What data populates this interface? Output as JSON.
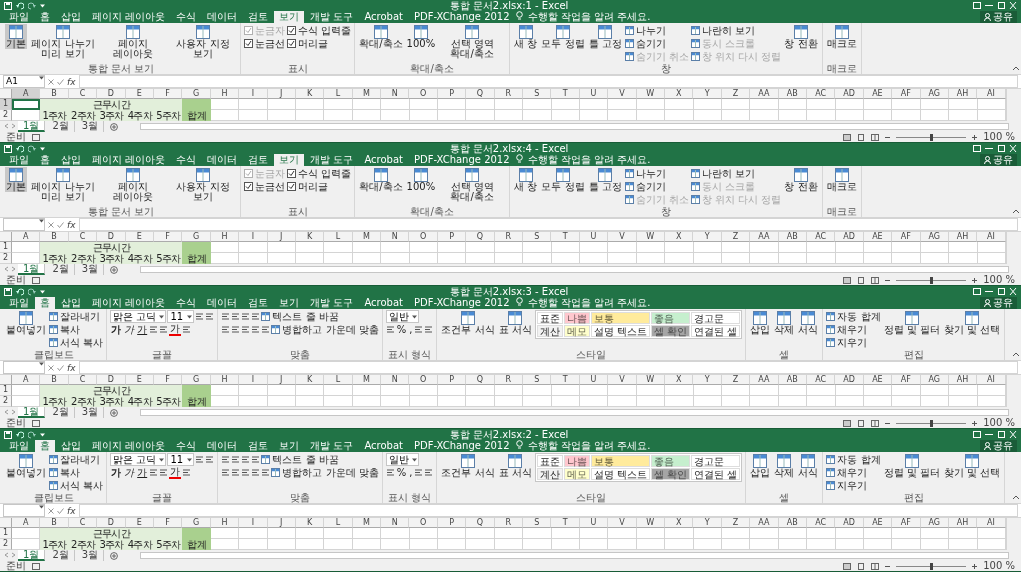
{
  "windows": [
    {
      "title": "통합 문서2.xlsx:1 - Excel",
      "tabs": [
        {
          "label": "파일",
          "selected": false
        },
        {
          "label": "홈",
          "selected": false
        },
        {
          "label": "삽입",
          "selected": false
        },
        {
          "label": "페이지 레이아웃",
          "selected": false
        },
        {
          "label": "수식",
          "selected": false
        },
        {
          "label": "데이터",
          "selected": false
        },
        {
          "label": "검토",
          "selected": false
        },
        {
          "label": "보기",
          "selected": true
        },
        {
          "label": "개발 도구",
          "selected": false
        },
        {
          "label": "Acrobat",
          "selected": false
        },
        {
          "label": "PDF-XChange 2012",
          "selected": false
        }
      ],
      "tell_me": "수행할 작업을 알려 주세요.",
      "share": "공유",
      "ribbon": [
        {
          "label": "통합 문서 보기",
          "columns": [
            [
              [
                {
                  "kind": "large",
                  "label": "기본",
                  "selected": true
                }
              ]
            ],
            [
              [
                {
                  "kind": "large",
                  "label": "페이지 나누기 미리 보기",
                  "selected": false
                }
              ]
            ],
            [
              [
                {
                  "kind": "large",
                  "label": "페이지 레이아웃",
                  "selected": false
                }
              ]
            ],
            [
              [
                {
                  "kind": "large",
                  "label": "사용자 지정 보기",
                  "selected": false
                }
              ]
            ]
          ]
        },
        {
          "label": "표시",
          "columns": [
            [
              [
                {
                  "kind": "check",
                  "label": "눈금자",
                  "checked": true,
                  "disabled": true
                }
              ],
              [
                {
                  "kind": "check",
                  "label": "눈금선",
                  "checked": true,
                  "disabled": false
                }
              ]
            ],
            [
              [
                {
                  "kind": "check",
                  "label": "수식 입력줄",
                  "checked": true,
                  "disabled": false
                }
              ],
              [
                {
                  "kind": "check",
                  "label": "머리글",
                  "checked": true,
                  "disabled": false
                }
              ]
            ]
          ]
        },
        {
          "label": "확대/축소",
          "columns": [
            [
              [
                {
                  "kind": "large",
                  "label": "확대/축소"
                }
              ]
            ],
            [
              [
                {
                  "kind": "large",
                  "label": "100%"
                }
              ]
            ],
            [
              [
                {
                  "kind": "large",
                  "label": "선택 영역 확대/축소"
                }
              ]
            ]
          ]
        },
        {
          "label": "창",
          "columns": [
            [
              [
                {
                  "kind": "large",
                  "label": "새 창"
                }
              ]
            ],
            [
              [
                {
                  "kind": "large",
                  "label": "모두 정렬"
                }
              ]
            ],
            [
              [
                {
                  "kind": "large",
                  "label": "틀 고정"
                }
              ]
            ],
            [
              [
                {
                  "kind": "small",
                  "label": "나누기",
                  "disabled": false
                }
              ],
              [
                {
                  "kind": "small",
                  "label": "숨기기",
                  "disabled": false
                }
              ],
              [
                {
                  "kind": "small",
                  "label": "숨기기 취소",
                  "disabled": true
                }
              ]
            ],
            [
              [
                {
                  "kind": "small",
                  "label": "나란히 보기",
                  "disabled": false
                }
              ],
              [
                {
                  "kind": "small",
                  "label": "동시 스크롤",
                  "disabled": true
                }
              ],
              [
                {
                  "kind": "small",
                  "label": "창 위치 다시 정렬",
                  "disabled": true
                }
              ]
            ],
            [
              [
                {
                  "kind": "large",
                  "label": "창 전환"
                }
              ]
            ]
          ]
        },
        {
          "label": "매크로",
          "columns": [
            [
              [
                {
                  "kind": "large",
                  "label": "매크로"
                }
              ]
            ]
          ]
        }
      ],
      "formula_bar": {
        "name_box": "A1",
        "function_label": "fx"
      },
      "columns": [
        "A",
        "B",
        "C",
        "D",
        "E",
        "F",
        "G",
        "H",
        "I",
        "J",
        "K",
        "L",
        "M",
        "N",
        "O",
        "P",
        "Q",
        "R",
        "S",
        "T",
        "U",
        "V",
        "W",
        "X",
        "Y",
        "Z",
        "AA",
        "AB",
        "AC",
        "AD",
        "AE",
        "AF",
        "AG",
        "AH",
        "AI"
      ],
      "rows": [
        {
          "header": "1",
          "cells": [
            {
              "selected": true
            },
            {
              "color": "#e2efda",
              "selected": false
            },
            {
              "color": "#e2efda",
              "selected": false
            },
            {
              "text": "근무시간",
              "color": "#e2efda",
              "selected": false
            },
            {
              "color": "#e2efda",
              "selected": false
            },
            {
              "color": "#e2efda",
              "selected": false
            },
            {
              "color": "#a9d08e",
              "selected": false
            }
          ]
        },
        {
          "header": "2",
          "cells": [
            {
              "selected": false
            },
            {
              "text": "1주차",
              "color": "#e2efda",
              "selected": false
            },
            {
              "text": "2주차",
              "color": "#e2efda",
              "selected": false
            },
            {
              "text": "3주차",
              "color": "#e2efda",
              "selected": false
            },
            {
              "text": "4주차",
              "color": "#e2efda",
              "selected": false
            },
            {
              "text": "5주차",
              "color": "#e2efda",
              "selected": false
            },
            {
              "text": "합계",
              "color": "#a9d08e",
              "selected": false
            }
          ]
        }
      ],
      "sheets": [
        {
          "label": "1월",
          "selected": true
        },
        {
          "label": "2월",
          "selected": false
        },
        {
          "label": "3월",
          "selected": false
        }
      ],
      "status": {
        "text": "준비",
        "zoom": {
          "level": 0.5,
          "reading": "100 %"
        }
      }
    },
    {
      "title": "통합 문서2.xlsx:4 - Excel",
      "tabs": [
        {
          "label": "파일",
          "selected": false
        },
        {
          "label": "홈",
          "selected": false
        },
        {
          "label": "삽입",
          "selected": false
        },
        {
          "label": "페이지 레이아웃",
          "selected": false
        },
        {
          "label": "수식",
          "selected": false
        },
        {
          "label": "데이터",
          "selected": false
        },
        {
          "label": "검토",
          "selected": false
        },
        {
          "label": "보기",
          "selected": true
        },
        {
          "label": "개발 도구",
          "selected": false
        },
        {
          "label": "Acrobat",
          "selected": false
        },
        {
          "label": "PDF-XChange 2012",
          "selected": false
        }
      ],
      "tell_me": "수행할 작업을 알려 주세요.",
      "share": "공유",
      "ribbon": [
        {
          "label": "통합 문서 보기",
          "columns": [
            [
              [
                {
                  "kind": "large",
                  "label": "기본",
                  "selected": true
                }
              ]
            ],
            [
              [
                {
                  "kind": "large",
                  "label": "페이지 나누기 미리 보기",
                  "selected": false
                }
              ]
            ],
            [
              [
                {
                  "kind": "large",
                  "label": "페이지 레이아웃",
                  "selected": false
                }
              ]
            ],
            [
              [
                {
                  "kind": "large",
                  "label": "사용자 지정 보기",
                  "selected": false
                }
              ]
            ]
          ]
        },
        {
          "label": "표시",
          "columns": [
            [
              [
                {
                  "kind": "check",
                  "label": "눈금자",
                  "checked": true,
                  "disabled": true
                }
              ],
              [
                {
                  "kind": "check",
                  "label": "눈금선",
                  "checked": true,
                  "disabled": false
                }
              ]
            ],
            [
              [
                {
                  "kind": "check",
                  "label": "수식 입력줄",
                  "checked": true,
                  "disabled": false
                }
              ],
              [
                {
                  "kind": "check",
                  "label": "머리글",
                  "checked": true,
                  "disabled": false
                }
              ]
            ]
          ]
        },
        {
          "label": "확대/축소",
          "columns": [
            [
              [
                {
                  "kind": "large",
                  "label": "확대/축소"
                }
              ]
            ],
            [
              [
                {
                  "kind": "large",
                  "label": "100%"
                }
              ]
            ],
            [
              [
                {
                  "kind": "large",
                  "label": "선택 영역 확대/축소"
                }
              ]
            ]
          ]
        },
        {
          "label": "창",
          "columns": [
            [
              [
                {
                  "kind": "large",
                  "label": "새 창"
                }
              ]
            ],
            [
              [
                {
                  "kind": "large",
                  "label": "모두 정렬"
                }
              ]
            ],
            [
              [
                {
                  "kind": "large",
                  "label": "틀 고정"
                }
              ]
            ],
            [
              [
                {
                  "kind": "small",
                  "label": "나누기",
                  "disabled": false
                }
              ],
              [
                {
                  "kind": "small",
                  "label": "숨기기",
                  "disabled": false
                }
              ],
              [
                {
                  "kind": "small",
                  "label": "숨기기 취소",
                  "disabled": true
                }
              ]
            ],
            [
              [
                {
                  "kind": "small",
                  "label": "나란히 보기",
                  "disabled": false
                }
              ],
              [
                {
                  "kind": "small",
                  "label": "동시 스크롤",
                  "disabled": true
                }
              ],
              [
                {
                  "kind": "small",
                  "label": "창 위치 다시 정렬",
                  "disabled": true
                }
              ]
            ],
            [
              [
                {
                  "kind": "large",
                  "label": "창 전환"
                }
              ]
            ]
          ]
        },
        {
          "label": "매크로",
          "columns": [
            [
              [
                {
                  "kind": "large",
                  "label": "매크로"
                }
              ]
            ]
          ]
        }
      ],
      "formula_bar": {
        "function_label": "fx"
      },
      "columns": [
        "A",
        "B",
        "C",
        "D",
        "E",
        "F",
        "G",
        "H",
        "I",
        "J",
        "K",
        "L",
        "M",
        "N",
        "O",
        "P",
        "Q",
        "R",
        "S",
        "T",
        "U",
        "V",
        "W",
        "X",
        "Y",
        "Z",
        "AA",
        "AB",
        "AC",
        "AD",
        "AE",
        "AF",
        "AG",
        "AH",
        "AI"
      ],
      "rows": [
        {
          "header": "1",
          "cells": [
            {
              "selected": false
            },
            {
              "color": "#e2efda",
              "selected": false
            },
            {
              "color": "#e2efda",
              "selected": false
            },
            {
              "text": "근무시간",
              "color": "#e2efda",
              "selected": false
            },
            {
              "color": "#e2efda",
              "selected": false
            },
            {
              "color": "#e2efda",
              "selected": false
            },
            {
              "color": "#a9d08e",
              "selected": false
            }
          ]
        },
        {
          "header": "2",
          "cells": [
            {
              "selected": false
            },
            {
              "text": "1주차",
              "color": "#e2efda",
              "selected": false
            },
            {
              "text": "2주차",
              "color": "#e2efda",
              "selected": false
            },
            {
              "text": "3주차",
              "color": "#e2efda",
              "selected": false
            },
            {
              "text": "4주차",
              "color": "#e2efda",
              "selected": false
            },
            {
              "text": "5주차",
              "color": "#e2efda",
              "selected": false
            },
            {
              "text": "합계",
              "color": "#a9d08e",
              "selected": false
            }
          ]
        }
      ],
      "sheets": [
        {
          "label": "1월",
          "selected": true
        },
        {
          "label": "2월",
          "selected": false
        },
        {
          "label": "3월",
          "selected": false
        }
      ],
      "status": {
        "text": "준비",
        "zoom": {
          "level": 0.5,
          "reading": "100 %"
        }
      }
    },
    {
      "title": "통합 문서2.xlsx:3 - Excel",
      "tabs": [
        {
          "label": "파일",
          "selected": false
        },
        {
          "label": "홈",
          "selected": true
        },
        {
          "label": "삽입",
          "selected": false
        },
        {
          "label": "페이지 레이아웃",
          "selected": false
        },
        {
          "label": "수식",
          "selected": false
        },
        {
          "label": "데이터",
          "selected": false
        },
        {
          "label": "검토",
          "selected": false
        },
        {
          "label": "보기",
          "selected": false
        },
        {
          "label": "개발 도구",
          "selected": false
        },
        {
          "label": "Acrobat",
          "selected": false
        },
        {
          "label": "PDF-XChange 2012",
          "selected": false
        }
      ],
      "tell_me": "수행할 작업을 알려 주세요.",
      "share": "공유",
      "ribbon": [
        {
          "label": "클립보드",
          "columns": [
            [
              [
                {
                  "kind": "large",
                  "label": "붙여넣기"
                }
              ]
            ],
            [
              [
                {
                  "kind": "small",
                  "label": "잘라내기",
                  "disabled": false
                }
              ],
              [
                {
                  "kind": "small",
                  "label": "복사",
                  "disabled": false
                }
              ],
              [
                {
                  "kind": "small",
                  "label": "서식 복사",
                  "disabled": false
                }
              ]
            ]
          ]
        },
        {
          "label": "글꼴",
          "columns": [
            [
              [
                {
                  "kind": "combo",
                  "value": "맑은 고딕"
                },
                {
                  "kind": "combo",
                  "value": "11"
                },
                {
                  "kind": "icon"
                },
                {
                  "kind": "icon"
                }
              ],
              [
                {
                  "kind": "bold",
                  "label": "가"
                },
                {
                  "kind": "italic",
                  "label": "가"
                },
                {
                  "kind": "underline",
                  "label": "가"
                },
                {
                  "kind": "icon"
                },
                {
                  "kind": "icon"
                },
                {
                  "kind": "font-color",
                  "label": "가"
                },
                {
                  "kind": "icon"
                }
              ]
            ]
          ]
        },
        {
          "label": "맞춤",
          "columns": [
            [
              [
                {
                  "kind": "icon"
                },
                {
                  "kind": "icon"
                },
                {
                  "kind": "icon"
                },
                {
                  "kind": "icon"
                },
                {
                  "kind": "small",
                  "label": "텍스트 줄 바꿈",
                  "disabled": false
                }
              ],
              [
                {
                  "kind": "icon"
                },
                {
                  "kind": "icon"
                },
                {
                  "kind": "icon"
                },
                {
                  "kind": "icon"
                },
                {
                  "kind": "icon"
                },
                {
                  "kind": "small",
                  "label": "병합하고 가운데 맞춤",
                  "disabled": false
                }
              ]
            ]
          ]
        },
        {
          "label": "표시 형식",
          "columns": [
            [
              [
                {
                  "kind": "combo",
                  "value": "일반"
                }
              ],
              [
                {
                  "kind": "icon"
                },
                {
                  "kind": "text",
                  "label": "%"
                },
                {
                  "kind": "text",
                  "label": ","
                },
                {
                  "kind": "icon"
                },
                {
                  "kind": "icon"
                }
              ]
            ]
          ]
        },
        {
          "label": "스타일",
          "columns": [
            [
              [
                {
                  "kind": "large",
                  "label": "조건부 서식"
                }
              ]
            ],
            [
              [
                {
                  "kind": "large",
                  "label": "표 서식"
                }
              ]
            ],
            [
              [
                {
                  "kind": "style",
                  "label": "표준",
                  "color": "#ffffff"
                },
                {
                  "kind": "style",
                  "label": "나쁨",
                  "color": "#ffc7ce"
                },
                {
                  "kind": "style",
                  "label": "보통",
                  "color": "#ffeb9c"
                },
                {
                  "kind": "style",
                  "label": "좋음",
                  "color": "#c6efce"
                },
                {
                  "kind": "style",
                  "label": "경고문",
                  "color": "#ffffff"
                }
              ],
              [
                {
                  "kind": "style",
                  "label": "계산",
                  "color": "#f2f2f2"
                },
                {
                  "kind": "style",
                  "label": "메모",
                  "color": "#ffffcc"
                },
                {
                  "kind": "style",
                  "label": "설명 텍스트",
                  "color": "#ffffff"
                },
                {
                  "kind": "style",
                  "label": "셀 확인",
                  "color": "#a5a5a5"
                },
                {
                  "kind": "style",
                  "label": "연결된 셀",
                  "color": "#ffffff"
                }
              ]
            ]
          ]
        },
        {
          "label": "셀",
          "columns": [
            [
              [
                {
                  "kind": "large",
                  "label": "삽입"
                }
              ]
            ],
            [
              [
                {
                  "kind": "large",
                  "label": "삭제"
                }
              ]
            ],
            [
              [
                {
                  "kind": "large",
                  "label": "서식"
                }
              ]
            ]
          ]
        },
        {
          "label": "편집",
          "columns": [
            [
              [
                {
                  "kind": "small",
                  "label": "자동 합계",
                  "disabled": false
                }
              ],
              [
                {
                  "kind": "small",
                  "label": "채우기",
                  "disabled": false
                }
              ],
              [
                {
                  "kind": "small",
                  "label": "지우기",
                  "disabled": false
                }
              ]
            ],
            [
              [
                {
                  "kind": "large",
                  "label": "정렬 및 필터"
                }
              ]
            ],
            [
              [
                {
                  "kind": "large",
                  "label": "찾기 및 선택"
                }
              ]
            ]
          ]
        }
      ],
      "formula_bar": {
        "function_label": "fx"
      },
      "columns": [
        "A",
        "B",
        "C",
        "D",
        "E",
        "F",
        "G",
        "H",
        "I",
        "J",
        "K",
        "L",
        "M",
        "N",
        "O",
        "P",
        "Q",
        "R",
        "S",
        "T",
        "U",
        "V",
        "W",
        "X",
        "Y",
        "Z",
        "AA",
        "AB",
        "AC",
        "AD",
        "AE",
        "AF",
        "AG",
        "AH",
        "AI"
      ],
      "rows": [
        {
          "header": "1",
          "cells": [
            {
              "selected": false
            },
            {
              "color": "#e2efda",
              "selected": false
            },
            {
              "color": "#e2efda",
              "selected": false
            },
            {
              "text": "근무시간",
              "color": "#e2efda",
              "selected": false
            },
            {
              "color": "#e2efda",
              "selected": false
            },
            {
              "color": "#e2efda",
              "selected": false
            },
            {
              "color": "#a9d08e",
              "selected": false
            }
          ]
        },
        {
          "header": "2",
          "cells": [
            {
              "selected": false
            },
            {
              "text": "1주차",
              "color": "#e2efda",
              "selected": false
            },
            {
              "text": "2주차",
              "color": "#e2efda",
              "selected": false
            },
            {
              "text": "3주차",
              "color": "#e2efda",
              "selected": false
            },
            {
              "text": "4주차",
              "color": "#e2efda",
              "selected": false
            },
            {
              "text": "5주차",
              "color": "#e2efda",
              "selected": false
            },
            {
              "text": "합계",
              "color": "#a9d08e",
              "selected": false
            }
          ]
        }
      ],
      "sheets": [
        {
          "label": "1월",
          "selected": true
        },
        {
          "label": "2월",
          "selected": false
        },
        {
          "label": "3월",
          "selected": false
        }
      ],
      "status": {
        "text": "준비",
        "zoom": {
          "level": 0.5,
          "reading": "100 %"
        }
      }
    },
    {
      "title": "통합 문서2.xlsx:2 - Excel",
      "tabs": [
        {
          "label": "파일",
          "selected": false
        },
        {
          "label": "홈",
          "selected": true
        },
        {
          "label": "삽입",
          "selected": false
        },
        {
          "label": "페이지 레이아웃",
          "selected": false
        },
        {
          "label": "수식",
          "selected": false
        },
        {
          "label": "데이터",
          "selected": false
        },
        {
          "label": "검토",
          "selected": false
        },
        {
          "label": "보기",
          "selected": false
        },
        {
          "label": "개발 도구",
          "selected": false
        },
        {
          "label": "Acrobat",
          "selected": false
        },
        {
          "label": "PDF-XChange 2012",
          "selected": false
        }
      ],
      "tell_me": "수행할 작업을 알려 주세요.",
      "share": "공유",
      "ribbon": [
        {
          "label": "클립보드",
          "columns": [
            [
              [
                {
                  "kind": "large",
                  "label": "붙여넣기"
                }
              ]
            ],
            [
              [
                {
                  "kind": "small",
                  "label": "잘라내기",
                  "disabled": false
                }
              ],
              [
                {
                  "kind": "small",
                  "label": "복사",
                  "disabled": false
                }
              ],
              [
                {
                  "kind": "small",
                  "label": "서식 복사",
                  "disabled": false
                }
              ]
            ]
          ]
        },
        {
          "label": "글꼴",
          "columns": [
            [
              [
                {
                  "kind": "combo",
                  "value": "맑은 고딕"
                },
                {
                  "kind": "combo",
                  "value": "11"
                },
                {
                  "kind": "icon"
                },
                {
                  "kind": "icon"
                }
              ],
              [
                {
                  "kind": "bold",
                  "label": "가"
                },
                {
                  "kind": "italic",
                  "label": "가"
                },
                {
                  "kind": "underline",
                  "label": "가"
                },
                {
                  "kind": "icon"
                },
                {
                  "kind": "icon"
                },
                {
                  "kind": "font-color",
                  "label": "가"
                },
                {
                  "kind": "icon"
                }
              ]
            ]
          ]
        },
        {
          "label": "맞춤",
          "columns": [
            [
              [
                {
                  "kind": "icon"
                },
                {
                  "kind": "icon"
                },
                {
                  "kind": "icon"
                },
                {
                  "kind": "icon"
                },
                {
                  "kind": "small",
                  "label": "텍스트 줄 바꿈",
                  "disabled": false
                }
              ],
              [
                {
                  "kind": "icon"
                },
                {
                  "kind": "icon"
                },
                {
                  "kind": "icon"
                },
                {
                  "kind": "icon"
                },
                {
                  "kind": "icon"
                },
                {
                  "kind": "small",
                  "label": "병합하고 가운데 맞춤",
                  "disabled": false
                }
              ]
            ]
          ]
        },
        {
          "label": "표시 형식",
          "columns": [
            [
              [
                {
                  "kind": "combo",
                  "value": "일반"
                }
              ],
              [
                {
                  "kind": "icon"
                },
                {
                  "kind": "text",
                  "label": "%"
                },
                {
                  "kind": "text",
                  "label": ","
                },
                {
                  "kind": "icon"
                },
                {
                  "kind": "icon"
                }
              ]
            ]
          ]
        },
        {
          "label": "스타일",
          "columns": [
            [
              [
                {
                  "kind": "large",
                  "label": "조건부 서식"
                }
              ]
            ],
            [
              [
                {
                  "kind": "large",
                  "label": "표 서식"
                }
              ]
            ],
            [
              [
                {
                  "kind": "style",
                  "label": "표준",
                  "color": "#ffffff"
                },
                {
                  "kind": "style",
                  "label": "나쁨",
                  "color": "#ffc7ce"
                },
                {
                  "kind": "style",
                  "label": "보통",
                  "color": "#ffeb9c"
                },
                {
                  "kind": "style",
                  "label": "좋음",
                  "color": "#c6efce"
                },
                {
                  "kind": "style",
                  "label": "경고문",
                  "color": "#ffffff"
                }
              ],
              [
                {
                  "kind": "style",
                  "label": "계산",
                  "color": "#f2f2f2"
                },
                {
                  "kind": "style",
                  "label": "메모",
                  "color": "#ffffcc"
                },
                {
                  "kind": "style",
                  "label": "설명 텍스트",
                  "color": "#ffffff"
                },
                {
                  "kind": "style",
                  "label": "셀 확인",
                  "color": "#a5a5a5"
                },
                {
                  "kind": "style",
                  "label": "연결된 셀",
                  "color": "#ffffff"
                }
              ]
            ]
          ]
        },
        {
          "label": "셀",
          "columns": [
            [
              [
                {
                  "kind": "large",
                  "label": "삽입"
                }
              ]
            ],
            [
              [
                {
                  "kind": "large",
                  "label": "삭제"
                }
              ]
            ],
            [
              [
                {
                  "kind": "large",
                  "label": "서식"
                }
              ]
            ]
          ]
        },
        {
          "label": "편집",
          "columns": [
            [
              [
                {
                  "kind": "small",
                  "label": "자동 합계",
                  "disabled": false
                }
              ],
              [
                {
                  "kind": "small",
                  "label": "채우기",
                  "disabled": false
                }
              ],
              [
                {
                  "kind": "small",
                  "label": "지우기",
                  "disabled": false
                }
              ]
            ],
            [
              [
                {
                  "kind": "large",
                  "label": "정렬 및 필터"
                }
              ]
            ],
            [
              [
                {
                  "kind": "large",
                  "label": "찾기 및 선택"
                }
              ]
            ]
          ]
        }
      ],
      "formula_bar": {
        "function_label": "fx"
      },
      "columns": [
        "A",
        "B",
        "C",
        "D",
        "E",
        "F",
        "G",
        "H",
        "I",
        "J",
        "K",
        "L",
        "M",
        "N",
        "O",
        "P",
        "Q",
        "R",
        "S",
        "T",
        "U",
        "V",
        "W",
        "X",
        "Y",
        "Z",
        "AA",
        "AB",
        "AC",
        "AD",
        "AE",
        "AF",
        "AG",
        "AH",
        "AI"
      ],
      "rows": [
        {
          "header": "1",
          "cells": [
            {
              "selected": false
            },
            {
              "color": "#e2efda",
              "selected": false
            },
            {
              "color": "#e2efda",
              "selected": false
            },
            {
              "text": "근무시간",
              "color": "#e2efda",
              "selected": false
            },
            {
              "color": "#e2efda",
              "selected": false
            },
            {
              "color": "#e2efda",
              "selected": false
            },
            {
              "color": "#a9d08e",
              "selected": false
            }
          ]
        },
        {
          "header": "2",
          "cells": [
            {
              "selected": false
            },
            {
              "text": "1주차",
              "color": "#e2efda",
              "selected": false
            },
            {
              "text": "2주차",
              "color": "#e2efda",
              "selected": false
            },
            {
              "text": "3주차",
              "color": "#e2efda",
              "selected": false
            },
            {
              "text": "4주차",
              "color": "#e2efda",
              "selected": false
            },
            {
              "text": "5주차",
              "color": "#e2efda",
              "selected": false
            },
            {
              "text": "합계",
              "color": "#a9d08e",
              "selected": false
            }
          ]
        }
      ],
      "sheets": [
        {
          "label": "1월",
          "selected": true
        },
        {
          "label": "2월",
          "selected": false
        },
        {
          "label": "3월",
          "selected": false
        }
      ],
      "status": {
        "text": "준비",
        "zoom": {
          "level": 0.5,
          "reading": "100 %"
        }
      }
    }
  ]
}
